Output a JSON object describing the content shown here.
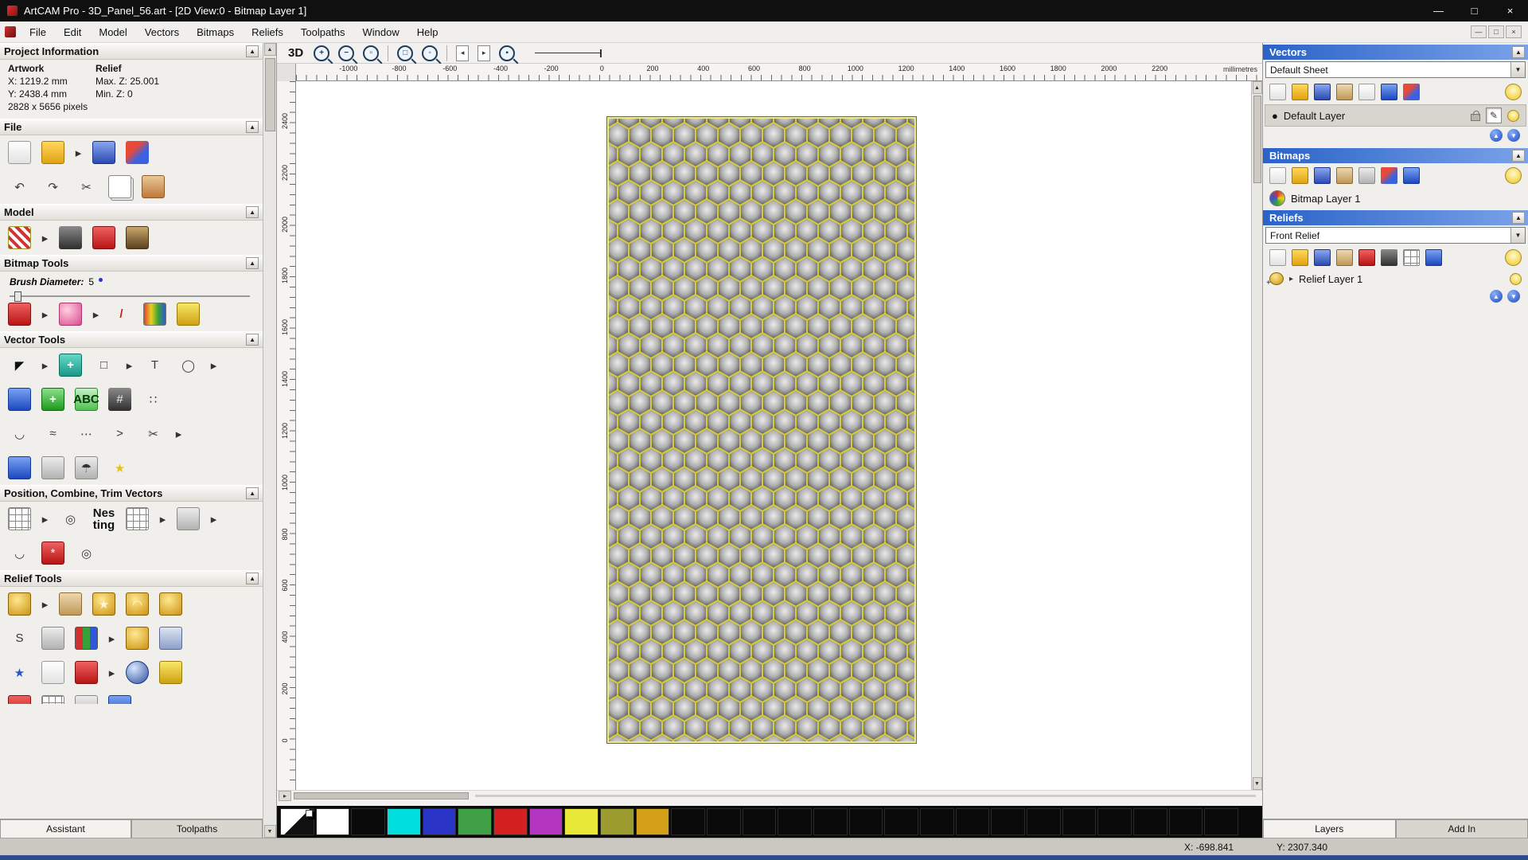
{
  "window": {
    "title": "ArtCAM Pro - 3D_Panel_56.art - [2D View:0 - Bitmap Layer 1]",
    "minimize": "—",
    "maximize": "□",
    "close": "×"
  },
  "ui": {
    "collapse": "▲",
    "dropdown": "▼",
    "flyout": "▸",
    "up": "▲",
    "down": "▼",
    "scroll_up": "▲",
    "scroll_down": "▼",
    "scroll_left": "▸",
    "pencil": "✎"
  },
  "menubar": {
    "items": [
      "File",
      "Edit",
      "Model",
      "Vectors",
      "Bitmaps",
      "Reliefs",
      "Toolpaths",
      "Window",
      "Help"
    ],
    "mdi": {
      "minimize": "—",
      "restore": "□",
      "close": "×"
    }
  },
  "viewbar": {
    "btn_3d": "3D",
    "tools": [
      {
        "name": "zoom-in-icon",
        "cls": "t-mag",
        "g": "+"
      },
      {
        "name": "zoom-out-icon",
        "cls": "t-mag",
        "g": "−"
      },
      {
        "name": "zoom-box-icon",
        "cls": "t-mag",
        "g": "▫"
      },
      {
        "name": "toolbar-separator",
        "cls": "t-sep"
      },
      {
        "name": "zoom-page-icon",
        "cls": "t-mag",
        "g": "□"
      },
      {
        "name": "zoom-objects-icon",
        "cls": "t-mag",
        "g": "◦"
      },
      {
        "name": "toolbar-separator",
        "cls": "t-sep"
      },
      {
        "name": "previous-view-icon",
        "cls": "t-page",
        "g": "◂"
      },
      {
        "name": "next-view-icon",
        "cls": "t-page",
        "g": "▸"
      },
      {
        "name": "zoom-selected-icon",
        "cls": "t-mag",
        "g": "▪"
      }
    ]
  },
  "rulers": {
    "h_labels": [
      "-1000",
      "-800",
      "-600",
      "-400",
      "-200",
      "0",
      "200",
      "400",
      "600",
      "800",
      "1000",
      "1200",
      "1400",
      "1600",
      "1800",
      "2000",
      "2200"
    ],
    "unit": "millimetres",
    "v_labels": [
      "2400",
      "2200",
      "2000",
      "1800",
      "1600",
      "1400",
      "1200",
      "1000",
      "800",
      "600",
      "400",
      "200",
      "0"
    ]
  },
  "left": {
    "project": {
      "title": "Project Information",
      "artwork": "Artwork",
      "relief": "Relief",
      "x": "X: 1219.2 mm",
      "maxz": "Max. Z: 25.001",
      "y": "Y: 2438.4 mm",
      "minz": "Min. Z: 0",
      "pixels": "2828 x 5656 pixels"
    },
    "file": {
      "title": "File",
      "row1": [
        {
          "name": "new-model-icon",
          "cls": "k-page"
        },
        {
          "name": "open-model-icon",
          "cls": "k-folder"
        },
        {
          "name": "flyout-arrow",
          "cls": "k-fly",
          "g": "▸"
        },
        {
          "name": "save-model-icon",
          "cls": "k-disk"
        },
        {
          "name": "import-export-icon",
          "cls": "k-multi"
        }
      ],
      "row2": [
        {
          "name": "undo-icon",
          "cls": "k-plain",
          "g": "↶"
        },
        {
          "name": "redo-icon",
          "cls": "k-plain",
          "g": "↷"
        },
        {
          "name": "cut-icon",
          "cls": "k-plain",
          "g": "✂"
        },
        {
          "name": "copy-icon",
          "cls": "k-copy"
        },
        {
          "name": "paste-icon",
          "cls": "k-paste"
        }
      ]
    },
    "model": {
      "title": "Model",
      "row": [
        {
          "name": "set-model-size-icon",
          "cls": "k-redwhite"
        },
        {
          "name": "flyout-arrow",
          "cls": "k-fly",
          "g": "▸"
        },
        {
          "name": "model-lighting-icon",
          "cls": "k-dark"
        },
        {
          "name": "notes-icon",
          "cls": "k-red"
        },
        {
          "name": "model-preview-icon",
          "cls": "k-monalisa"
        }
      ]
    },
    "bitmap_tools": {
      "title": "Bitmap Tools",
      "brush_label": "Brush Diameter:",
      "brush_value": "5",
      "row": [
        {
          "name": "paint-icon",
          "cls": "k-red"
        },
        {
          "name": "flyout-arrow",
          "cls": "k-fly",
          "g": "▸"
        },
        {
          "name": "paint-selective-icon",
          "cls": "k-pink"
        },
        {
          "name": "flyout-arrow",
          "cls": "k-fly",
          "g": "▸"
        },
        {
          "name": "colour-picker-icon",
          "cls": "k-dropper",
          "g": "/"
        },
        {
          "name": "palette-icon",
          "cls": "k-palette"
        },
        {
          "name": "flood-fill-icon",
          "cls": "k-bucket"
        }
      ]
    },
    "vector_tools": {
      "title": "Vector Tools",
      "r1": [
        {
          "name": "select-vectors-icon",
          "cls": "k-cursor",
          "g": "◤"
        },
        {
          "name": "flyout-arrow",
          "cls": "k-fly",
          "g": "▸"
        },
        {
          "name": "transform-vectors-icon",
          "cls": "k-teal",
          "g": "+"
        },
        {
          "name": "create-rectangle-icon",
          "cls": "k-plain",
          "g": "□"
        },
        {
          "name": "flyout-arrow",
          "cls": "k-fly",
          "g": "▸"
        },
        {
          "name": "create-text-icon",
          "cls": "k-plain",
          "g": "T"
        },
        {
          "name": "create-ellipse-icon",
          "cls": "k-plain",
          "g": "◯"
        },
        {
          "name": "flyout-arrow",
          "cls": "k-fly",
          "g": "▸"
        }
      ],
      "r2": [
        {
          "name": "envelope-tool-icon",
          "cls": "k-blue"
        },
        {
          "name": "create-polyline-icon",
          "cls": "k-green",
          "g": "+"
        },
        {
          "name": "paste-text-icon",
          "cls": "k-green2",
          "g": "ABC"
        },
        {
          "name": "vector-grid-icon",
          "cls": "k-dark",
          "g": "#"
        },
        {
          "name": "point-array-icon",
          "cls": "k-plain",
          "g": "∷"
        }
      ],
      "r3": [
        {
          "name": "fit-curve-icon",
          "cls": "k-plain",
          "g": "◡"
        },
        {
          "name": "smooth-vector-icon",
          "cls": "k-plain",
          "g": "≈"
        },
        {
          "name": "free-curve-icon",
          "cls": "k-plain",
          "g": "⋯"
        },
        {
          "name": "node-edit-icon",
          "cls": "k-plain",
          "g": ">"
        },
        {
          "name": "vector-doctor-icon",
          "cls": "k-plain",
          "g": "✂"
        },
        {
          "name": "flyout-arrow",
          "cls": "k-fly",
          "g": "▸"
        }
      ],
      "r4": [
        {
          "name": "extrude-wizard-icon",
          "cls": "k-blue"
        },
        {
          "name": "wrap-vectors-icon",
          "cls": "k-gray"
        },
        {
          "name": "measure-tool-icon",
          "cls": "k-gray",
          "g": "☂"
        },
        {
          "name": "create-star-icon",
          "cls": "k-star",
          "g": "★"
        }
      ]
    },
    "position_tools": {
      "title": "Position, Combine, Trim Vectors",
      "r1": [
        {
          "name": "align-vectors-icon",
          "cls": "k-grid"
        },
        {
          "name": "flyout-arrow",
          "cls": "k-fly",
          "g": "▸"
        },
        {
          "name": "block-array-icon",
          "cls": "k-plain",
          "g": "◎"
        },
        {
          "name": "nesting-icon",
          "cls": "k-nest",
          "g": "Nes\nting"
        },
        {
          "name": "grid-copy-icon",
          "cls": "k-grid"
        },
        {
          "name": "flyout-arrow",
          "cls": "k-fly",
          "g": "▸"
        },
        {
          "name": "weld-vectors-icon",
          "cls": "k-gray"
        },
        {
          "name": "flyout-arrow",
          "cls": "k-fly",
          "g": "▸"
        }
      ],
      "r2": [
        {
          "name": "join-vectors-icon",
          "cls": "k-plain",
          "g": "◡"
        },
        {
          "name": "interactive-distort-icon",
          "cls": "k-red",
          "g": "*"
        },
        {
          "name": "spiral-tool-icon",
          "cls": "k-plain",
          "g": "◎"
        }
      ]
    },
    "relief_tools": {
      "title": "Relief Tools",
      "r1": [
        {
          "name": "shape-editor-icon",
          "cls": "k-gold"
        },
        {
          "name": "flyout-arrow",
          "cls": "k-fly",
          "g": "▸"
        },
        {
          "name": "sculpting-icon",
          "cls": "k-tan"
        },
        {
          "name": "texture-relief-icon",
          "cls": "k-gold",
          "g": "★"
        },
        {
          "name": "dome-relief-icon",
          "cls": "k-gold",
          "g": "◠"
        },
        {
          "name": "two-rail-sweep-icon",
          "cls": "k-gold"
        }
      ],
      "r2": [
        {
          "name": "swept-profile-icon",
          "cls": "k-plain",
          "g": "S"
        },
        {
          "name": "weave-wizard-icon",
          "cls": "k-gray"
        },
        {
          "name": "relief-clipart-icon",
          "cls": "k-books"
        },
        {
          "name": "flyout-arrow",
          "cls": "k-fly",
          "g": "▸"
        },
        {
          "name": "drip-feed-icon",
          "cls": "k-gold"
        },
        {
          "name": "relief-lock-icon",
          "cls": "k-lock"
        }
      ],
      "r3": [
        {
          "name": "star-relief-icon",
          "cls": "k-bluestar",
          "g": "★"
        },
        {
          "name": "unwrap-relief-icon",
          "cls": "k-page"
        },
        {
          "name": "emboss-wizard-icon",
          "cls": "k-red"
        },
        {
          "name": "flyout-arrow",
          "cls": "k-fly",
          "g": "▸"
        },
        {
          "name": "texture-sphere-icon",
          "cls": "k-bluesphere"
        },
        {
          "name": "relief-layer-stack-icon",
          "cls": "k-bucket"
        }
      ],
      "r4": [
        {
          "name": "offset-relief-icon",
          "cls": "k-red"
        },
        {
          "name": "mesh-tool-icon",
          "cls": "k-grid"
        },
        {
          "name": "smooth-relief-icon",
          "cls": "k-gray"
        },
        {
          "name": "scale-relief-icon",
          "cls": "k-blue"
        }
      ]
    },
    "tabs": [
      {
        "label": "Assistant",
        "name": "tab-assistant",
        "cls": "active"
      },
      {
        "label": "Toolpaths",
        "name": "tab-toolpaths"
      }
    ]
  },
  "right": {
    "vectors": {
      "title": "Vectors",
      "sheet": "Default Sheet",
      "icons": [
        {
          "name": "new-vector-layer-icon",
          "cls": "k-page"
        },
        {
          "name": "open-vector-file-icon",
          "cls": "k-folder"
        },
        {
          "name": "save-vector-layer-icon",
          "cls": "k-disk"
        },
        {
          "name": "import-vectors-icon",
          "cls": "k-tan"
        },
        {
          "name": "new-sheet-icon",
          "cls": "k-page"
        },
        {
          "name": "delete-vector-layer-icon",
          "cls": "k-blue"
        },
        {
          "name": "merge-visible-vectors-icon",
          "cls": "k-multi"
        }
      ],
      "layer": {
        "bullet": "●",
        "label": "Default Layer"
      }
    },
    "bitmaps": {
      "title": "Bitmaps",
      "icons": [
        {
          "name": "new-bitmap-layer-icon",
          "cls": "k-page"
        },
        {
          "name": "open-bitmap-file-icon",
          "cls": "k-folder"
        },
        {
          "name": "save-bitmap-layer-icon",
          "cls": "k-disk"
        },
        {
          "name": "import-bitmap-icon",
          "cls": "k-tan"
        },
        {
          "name": "greyscale-icon",
          "cls": "k-gray"
        },
        {
          "name": "colour-reduce-icon",
          "cls": "k-multi"
        },
        {
          "name": "delete-bitmap-layer-icon",
          "cls": "k-blue"
        }
      ],
      "layer": {
        "label": "Bitmap Layer 1"
      }
    },
    "reliefs": {
      "title": "Reliefs",
      "sheet": "Front Relief",
      "icons": [
        {
          "name": "new-relief-layer-icon",
          "cls": "k-page"
        },
        {
          "name": "open-relief-file-icon",
          "cls": "k-folder"
        },
        {
          "name": "save-relief-layer-icon",
          "cls": "k-disk"
        },
        {
          "name": "import-relief-icon",
          "cls": "k-tan"
        },
        {
          "name": "transform-relief-icon",
          "cls": "k-red"
        },
        {
          "name": "smooth-relief-layer-icon",
          "cls": "k-dark"
        },
        {
          "name": "scale-relief-layer-icon",
          "cls": "k-grid"
        },
        {
          "name": "delete-relief-layer-icon",
          "cls": "k-blue"
        }
      ],
      "layer": {
        "expander": "▸",
        "label": "Relief Layer 1"
      }
    },
    "tabs": [
      {
        "label": "Layers",
        "name": "tab-layers",
        "cls": "active"
      },
      {
        "label": "Add In",
        "name": "tab-add-in"
      }
    ]
  },
  "palette": {
    "swatches": [
      {
        "name": "primary-secondary-swatch",
        "cls": "sw-split"
      },
      {
        "name": "color-swatch",
        "hex": "#ffffff"
      },
      {
        "name": "color-swatch",
        "hex": "#0a0a0a"
      },
      {
        "name": "color-swatch",
        "hex": "#00dede"
      },
      {
        "name": "color-swatch",
        "hex": "#2a35c8"
      },
      {
        "name": "color-swatch",
        "hex": "#3fa045"
      },
      {
        "name": "color-swatch",
        "hex": "#d42020"
      },
      {
        "name": "color-swatch",
        "hex": "#b435c0"
      },
      {
        "name": "color-swatch",
        "hex": "#e8e838"
      },
      {
        "name": "color-swatch",
        "hex": "#9c9c2e"
      },
      {
        "name": "color-swatch",
        "hex": "#d4a018"
      },
      {
        "name": "color-swatch",
        "hex": "#0a0a0a"
      },
      {
        "name": "color-swatch",
        "hex": "#0a0a0a"
      },
      {
        "name": "color-swatch",
        "hex": "#0a0a0a"
      },
      {
        "name": "color-swatch",
        "hex": "#0a0a0a"
      },
      {
        "name": "color-swatch",
        "hex": "#0a0a0a"
      },
      {
        "name": "color-swatch",
        "hex": "#0a0a0a"
      },
      {
        "name": "color-swatch",
        "hex": "#0a0a0a"
      },
      {
        "name": "color-swatch",
        "hex": "#0a0a0a"
      },
      {
        "name": "color-swatch",
        "hex": "#0a0a0a"
      },
      {
        "name": "color-swatch",
        "hex": "#0a0a0a"
      },
      {
        "name": "color-swatch",
        "hex": "#0a0a0a"
      },
      {
        "name": "color-swatch",
        "hex": "#0a0a0a"
      },
      {
        "name": "color-swatch",
        "hex": "#0a0a0a"
      },
      {
        "name": "color-swatch",
        "hex": "#0a0a0a"
      },
      {
        "name": "color-swatch",
        "hex": "#0a0a0a"
      },
      {
        "name": "color-swatch",
        "hex": "#0a0a0a"
      }
    ]
  },
  "status": {
    "x": "X: -698.841",
    "y": "Y: 2307.340"
  }
}
